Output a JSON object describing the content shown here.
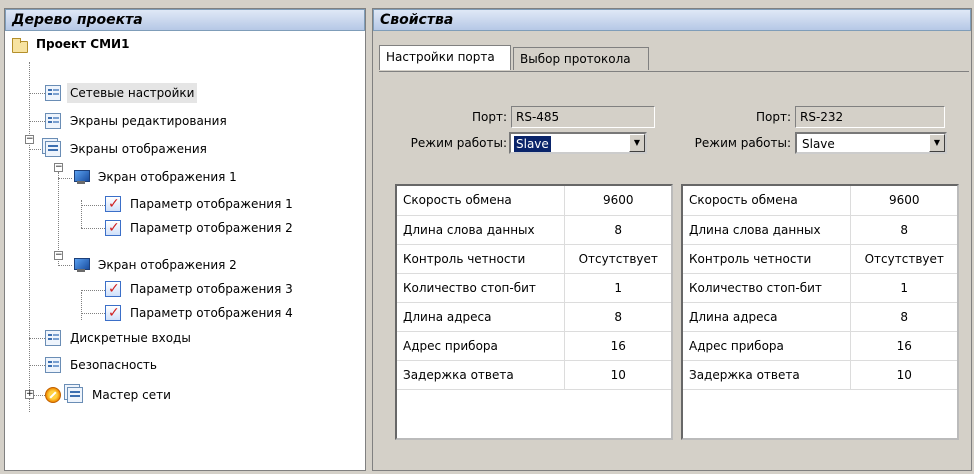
{
  "tree": {
    "header": "Дерево проекта",
    "root": "Проект СМИ1",
    "network": "Сетевые настройки",
    "edit_screens": "Экраны редактирования",
    "display_screens": "Экраны отображения",
    "screen1": "Экран отображения 1",
    "param1": "Параметр отображения 1",
    "param2": "Параметр отображения 2",
    "screen2": "Экран отображения 2",
    "param3": "Параметр отображения 3",
    "param4": "Параметр отображения 4",
    "discrete": "Дискретные входы",
    "security": "Безопасность",
    "master": "Мастер сети"
  },
  "props": {
    "header": "Свойства",
    "tabs": [
      "Настройки порта",
      "Выбор протокола"
    ],
    "left": {
      "port_label": "Порт:",
      "port_value": "RS-485",
      "mode_label": "Режим работы:",
      "mode_value": "Slave",
      "rows": [
        {
          "name": "Скорость обмена",
          "value": "9600"
        },
        {
          "name": "Длина слова данных",
          "value": "8"
        },
        {
          "name": "Контроль четности",
          "value": "Отсутствует"
        },
        {
          "name": "Количество стоп-бит",
          "value": "1"
        },
        {
          "name": "Длина адреса",
          "value": "8"
        },
        {
          "name": "Адрес прибора",
          "value": "16"
        },
        {
          "name": "Задержка ответа",
          "value": "10"
        }
      ]
    },
    "right": {
      "port_label": "Порт:",
      "port_value": "RS-232",
      "mode_label": "Режим работы:",
      "mode_value": "Slave",
      "rows": [
        {
          "name": "Скорость обмена",
          "value": "9600"
        },
        {
          "name": "Длина слова данных",
          "value": "8"
        },
        {
          "name": "Контроль четности",
          "value": "Отсутствует"
        },
        {
          "name": "Количество стоп-бит",
          "value": "1"
        },
        {
          "name": "Длина адреса",
          "value": "8"
        },
        {
          "name": "Адрес прибора",
          "value": "16"
        },
        {
          "name": "Задержка ответа",
          "value": "10"
        }
      ]
    }
  }
}
